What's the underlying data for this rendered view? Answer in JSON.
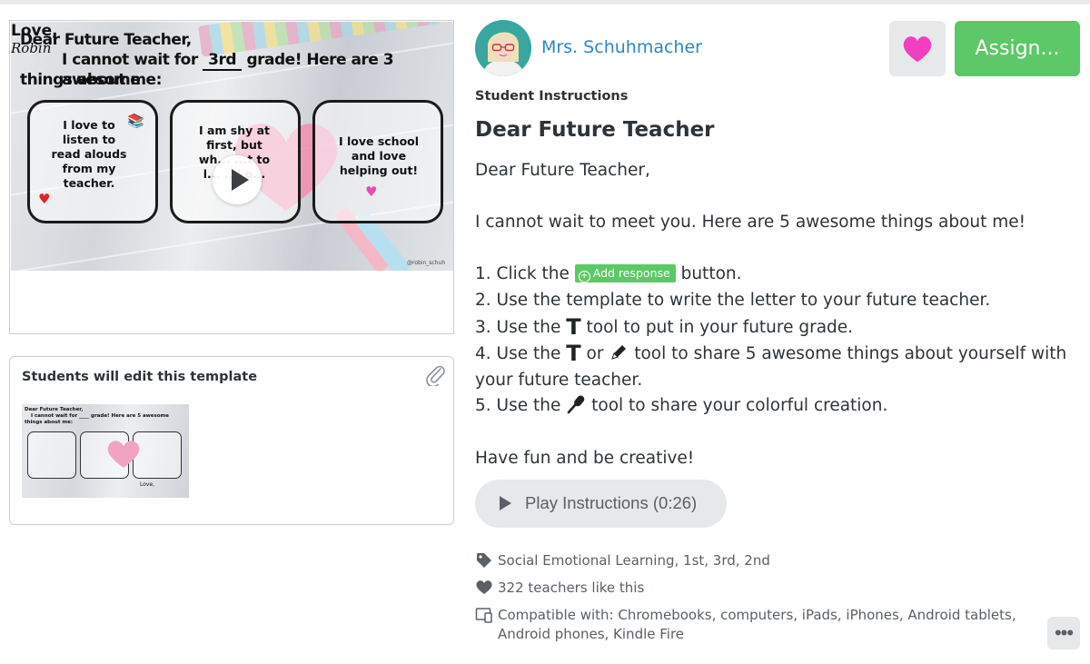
{
  "video_thumbnail": {
    "line1": "Dear Future Teacher,",
    "line2_prefix": "I cannot wait for",
    "line2_grade": "3rd",
    "line2_suffix": "grade! Here are 3 awesome",
    "line3": "things about me:",
    "box1": "I love to listen to read alouds from my teacher.",
    "box2": "I am shy at first, but wh... ...t to l... ...l o...",
    "box3": "I love school and love helping out!",
    "sign_love": "Love,",
    "sign_name": "Robin",
    "credit": "@robin_schuh"
  },
  "template_card": {
    "title": "Students will edit this template",
    "mini_line1": "Dear Future Teacher,",
    "mini_line2": "I cannot wait for ____ grade! Here are 5 awesome",
    "mini_line3": "things about me:",
    "mini_sign": "Love,"
  },
  "author": {
    "name": "Mrs. Schuhmacher"
  },
  "actions": {
    "assign_label": "Assign..."
  },
  "instructions": {
    "section_label": "Student Instructions",
    "title": "Dear Future Teacher",
    "greeting": "Dear Future Teacher,",
    "intro": "I cannot wait to meet you. Here are 5 awesome things about me!",
    "step1_pre": "1. Click the",
    "add_response_label": "Add response",
    "step1_post": "button.",
    "step2": "2. Use the template to write the letter to your future teacher.",
    "step3_pre": "3. Use the",
    "step3_post": "tool to put in your future grade.",
    "step4_pre": "4. Use the",
    "step4_mid": "or",
    "step4_post": "tool to share 5 awesome things about yourself with your future teacher.",
    "step5_pre": "5. Use the",
    "step5_post": "tool to share your colorful creation.",
    "closing": "Have fun and be creative!",
    "text_tool_glyph": "T",
    "play_label": "Play Instructions (0:26)"
  },
  "meta": {
    "tags": "Social Emotional Learning, 1st, 3rd, 2nd",
    "likes": "322 teachers like this",
    "compatible": "Compatible with: Chromebooks, computers, iPads, iPhones, Android tablets, Android phones, Kindle Fire"
  },
  "icons": {
    "like": "heart-icon",
    "attach": "paperclip-icon",
    "pencil": "pencil-icon",
    "mic": "microphone-icon",
    "tag": "tag-icon",
    "heart_meta": "heart-icon",
    "devices": "devices-icon",
    "more": "more-icon"
  },
  "colors": {
    "assign": "#5cc867",
    "author_link": "#2e86c1",
    "like_heart": "#f13fbf"
  }
}
